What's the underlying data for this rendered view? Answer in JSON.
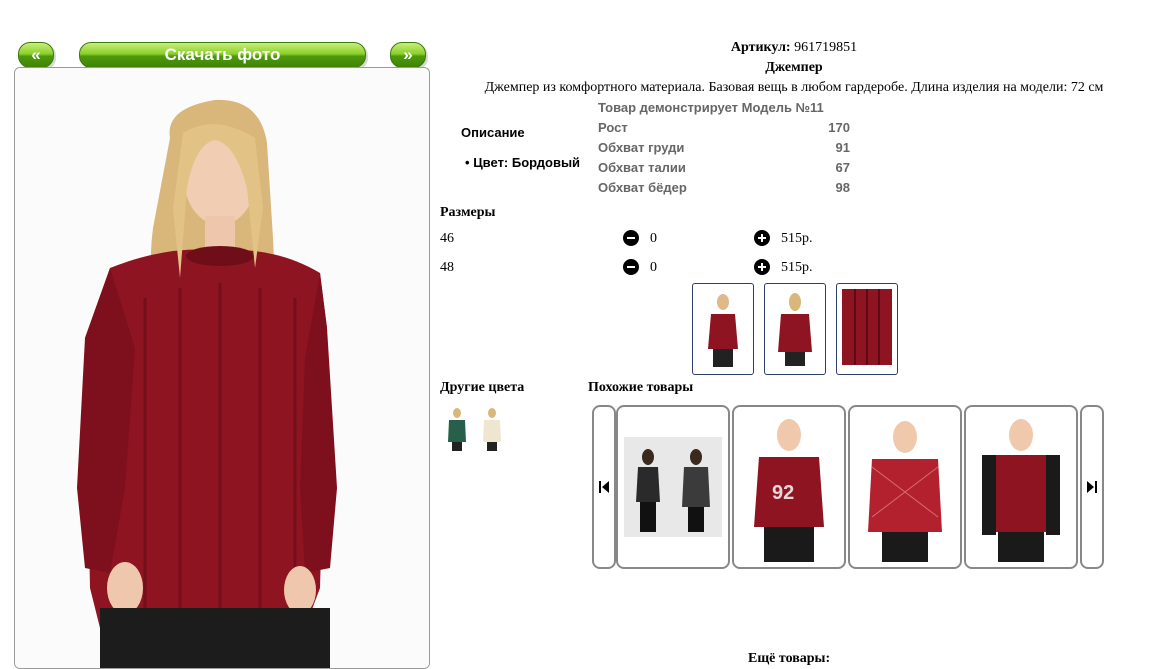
{
  "nav": {
    "prev_label": "«",
    "download_label": "Скачать фото",
    "next_label": "»"
  },
  "product": {
    "article_label": "Артикул:",
    "article_value": "961719851",
    "name": "Джемпер",
    "description": "Джемпер из комфортного материала. Базовая вещь в любом гардеробе. Длина изделия на модели: 72 см"
  },
  "details": {
    "section_title": "Описание",
    "color_item": "Цвет: Бордовый"
  },
  "model": {
    "title": "Товар демонстрирует Модель №11",
    "rows": [
      {
        "label": "Рост",
        "value": "170"
      },
      {
        "label": "Обхват груди",
        "value": "91"
      },
      {
        "label": "Обхват талии",
        "value": "67"
      },
      {
        "label": "Обхват бёдер",
        "value": "98"
      }
    ]
  },
  "sizes": {
    "title": "Размеры",
    "rows": [
      {
        "size": "46",
        "qty": "0",
        "price": "515р."
      },
      {
        "size": "48",
        "qty": "0",
        "price": "515р."
      }
    ]
  },
  "other_colors": {
    "title": "Другие цвета"
  },
  "similar": {
    "title": "Похожие товары"
  },
  "more": {
    "title": "Ещё товары:"
  },
  "colors": {
    "accent_green": "#5aa815",
    "sweater": "#8e1422",
    "frame_border": "#2c3e6a"
  }
}
